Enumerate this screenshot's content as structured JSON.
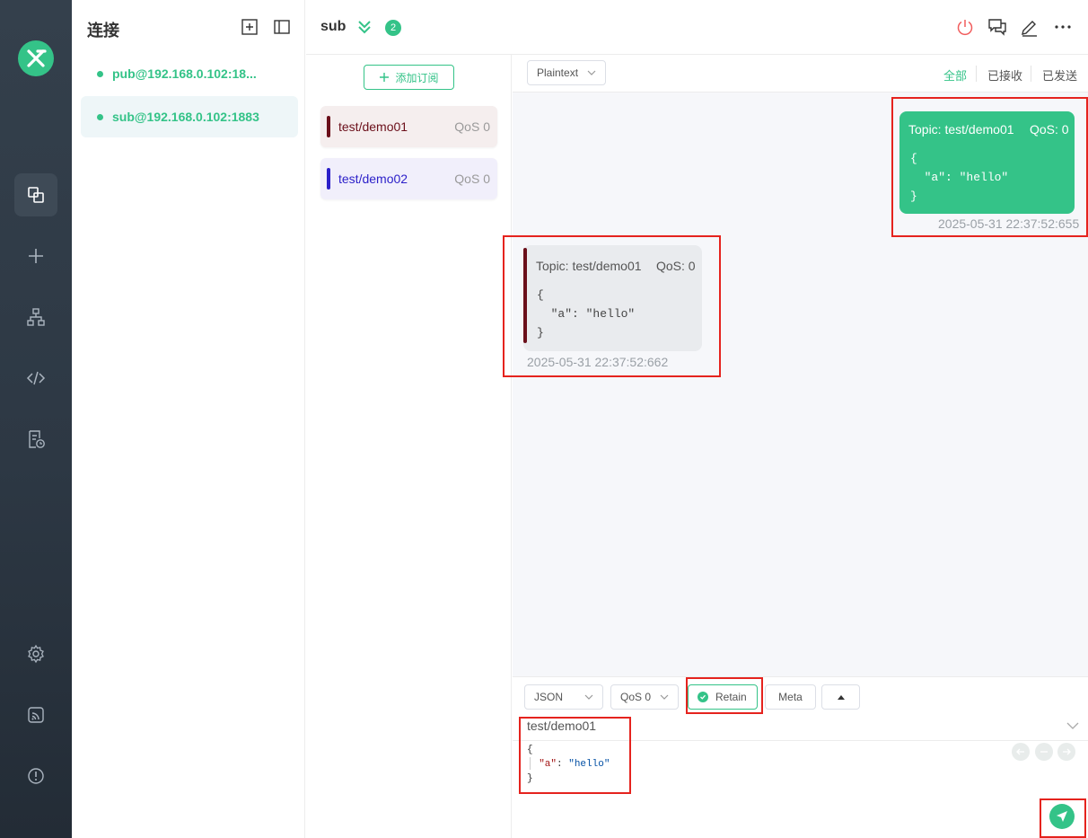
{
  "connections": {
    "title": "连接",
    "items": [
      {
        "name": "pub@192.168.0.102:18..."
      },
      {
        "name": "sub@192.168.0.102:1883"
      }
    ]
  },
  "header": {
    "name": "sub",
    "badge": "2"
  },
  "subscriptions": {
    "add_label": "添加订阅",
    "items": [
      {
        "topic": "test/demo01",
        "qos": "QoS 0",
        "color": "#6b0f1a",
        "bg": "#f5eeee"
      },
      {
        "topic": "test/demo02",
        "qos": "QoS 0",
        "color": "#2b1fc9",
        "bg": "#f1effb"
      }
    ]
  },
  "messages": {
    "format": "Plaintext",
    "filters": [
      "全部",
      "已接收",
      "已发送"
    ],
    "sent": {
      "topic": "Topic: test/demo01",
      "qos": "QoS: 0",
      "payload": "{\n  \"a\": \"hello\"\n}",
      "time": "2025-05-31 22:37:52:655"
    },
    "received": {
      "topic": "Topic: test/demo01",
      "qos": "QoS: 0",
      "payload": "{\n  \"a\": \"hello\"\n}",
      "time": "2025-05-31 22:37:52:662"
    }
  },
  "composer": {
    "payload_type": "JSON",
    "qos": "QoS 0",
    "retain_label": "Retain",
    "meta_label": "Meta",
    "topic": "test/demo01",
    "payload_open": "{",
    "payload_key": "\"a\"",
    "payload_colon": ": ",
    "payload_value": "\"hello\"",
    "payload_close": "}"
  },
  "colors": {
    "accent": "#34c388",
    "sidebar": "#2d3844",
    "highlight": "#e5231e"
  }
}
